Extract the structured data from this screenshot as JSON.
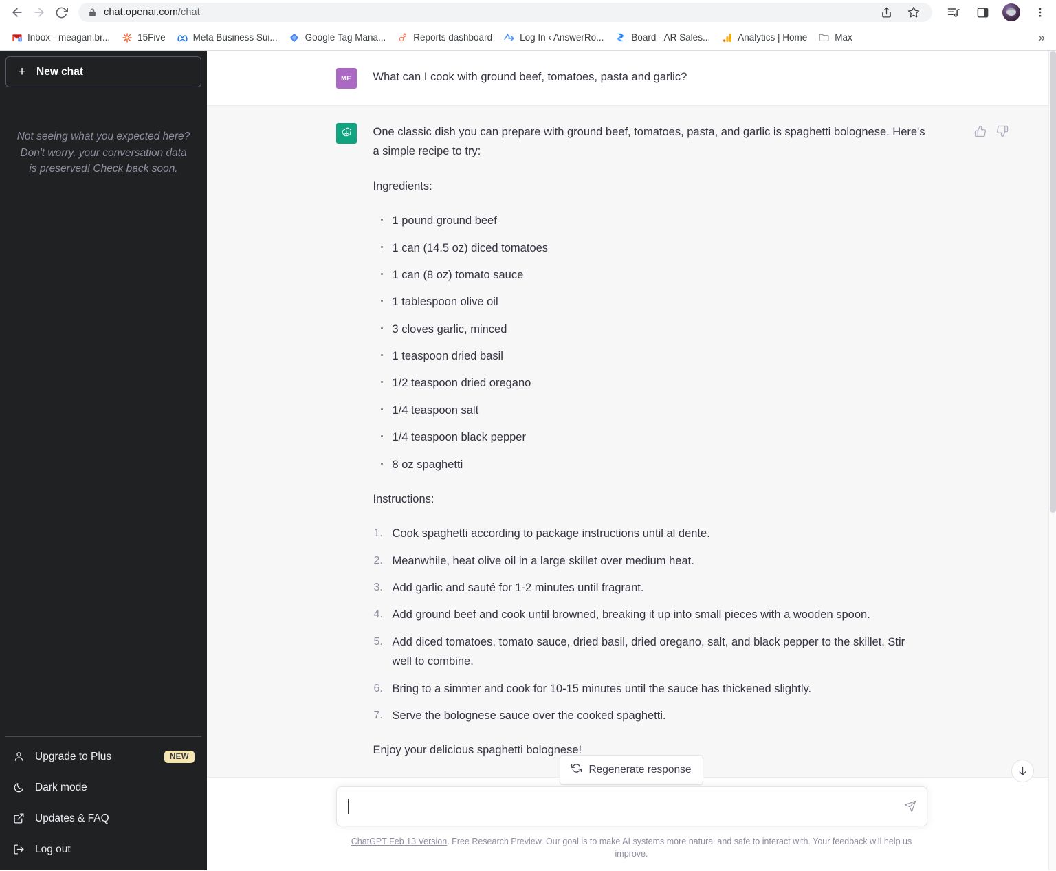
{
  "browser": {
    "url_bold": "chat.openai.com",
    "url_dim": "/chat",
    "back_icon": "back-arrow-icon",
    "forward_icon": "forward-arrow-icon",
    "reload_icon": "reload-icon",
    "lock_icon": "lock-icon",
    "share_icon": "share-icon",
    "bookmark_icon": "star-icon",
    "media_icon": "media-list-icon",
    "sidepanel_icon": "side-panel-icon",
    "profile_icon": "profile-avatar-icon",
    "menu_icon": "three-dot-menu-icon",
    "overflow_label": "»",
    "bookmarks": [
      {
        "label": "Inbox - meagan.br...",
        "icon": "gmail-icon"
      },
      {
        "label": "15Five",
        "icon": "fifteenfive-icon"
      },
      {
        "label": "Meta Business Sui...",
        "icon": "meta-icon"
      },
      {
        "label": "Google Tag Mana...",
        "icon": "google-tag-manager-icon"
      },
      {
        "label": "Reports dashboard",
        "icon": "hubspot-icon"
      },
      {
        "label": "Log In ‹ AnswerRo...",
        "icon": "answerrocket-icon"
      },
      {
        "label": "Board - AR Sales...",
        "icon": "jira-icon"
      },
      {
        "label": "Analytics | Home",
        "icon": "google-analytics-icon"
      },
      {
        "label": "Max",
        "icon": "folder-icon"
      }
    ]
  },
  "sidebar": {
    "new_chat_label": "New chat",
    "new_chat_icon": "plus-icon",
    "note": "Not seeing what you expected here? Don't worry, your conversation data is preserved! Check back soon.",
    "bottom_items": [
      {
        "label": "Upgrade to Plus",
        "icon": "person-icon",
        "badge": "NEW"
      },
      {
        "label": "Dark mode",
        "icon": "moon-icon",
        "badge": ""
      },
      {
        "label": "Updates & FAQ",
        "icon": "external-link-icon",
        "badge": ""
      },
      {
        "label": "Log out",
        "icon": "logout-icon",
        "badge": ""
      }
    ]
  },
  "chat": {
    "user": {
      "avatar_initials": "ME",
      "message": "What can I cook with ground beef, tomatoes, pasta and garlic?"
    },
    "assistant": {
      "avatar_icon": "openai-logo-icon",
      "intro": "One classic dish you can prepare with ground beef, tomatoes, pasta, and garlic is spaghetti bolognese. Here's a simple recipe to try:",
      "ingredients_heading": "Ingredients:",
      "ingredients": [
        "1 pound ground beef",
        "1 can (14.5 oz) diced tomatoes",
        "1 can (8 oz) tomato sauce",
        "1 tablespoon olive oil",
        "3 cloves garlic, minced",
        "1 teaspoon dried basil",
        "1/2 teaspoon dried oregano",
        "1/4 teaspoon salt",
        "1/4 teaspoon black pepper",
        "8 oz spaghetti"
      ],
      "instructions_heading": "Instructions:",
      "instructions": [
        "Cook spaghetti according to package instructions until al dente.",
        "Meanwhile, heat olive oil in a large skillet over medium heat.",
        "Add garlic and sauté for 1-2 minutes until fragrant.",
        "Add ground beef and cook until browned, breaking it up into small pieces with a wooden spoon.",
        "Add diced tomatoes, tomato sauce, dried basil, dried oregano, salt, and black pepper to the skillet. Stir well to combine.",
        "Bring to a simmer and cook for 10-15 minutes until the sauce has thickened slightly.",
        "Serve the bolognese sauce over the cooked spaghetti."
      ],
      "closing": "Enjoy your delicious spaghetti bolognese!",
      "thumbs_up_icon": "thumbs-up-icon",
      "thumbs_down_icon": "thumbs-down-icon"
    }
  },
  "composer": {
    "regenerate_label": "Regenerate response",
    "regenerate_icon": "refresh-icon",
    "input_value": "",
    "input_placeholder": "",
    "send_icon": "send-icon",
    "scroll_down_icon": "arrow-down-icon",
    "footer_link": "ChatGPT Feb 13 Version",
    "footer_rest": ". Free Research Preview. Our goal is to make AI systems more natural and safe to interact with. Your feedback will help us improve."
  },
  "colors": {
    "sidebar_bg": "#202123",
    "assistant_row_bg": "#f7f7f8",
    "user_avatar": "#ab68c4",
    "bot_avatar": "#10a37f",
    "badge_new_bg": "#f5e6b1"
  }
}
